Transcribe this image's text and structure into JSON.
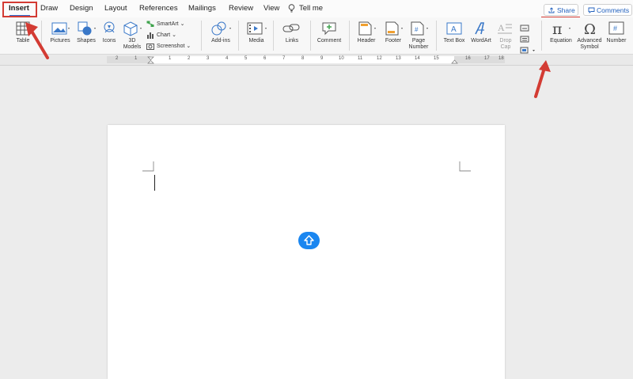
{
  "tabs": [
    {
      "label": "Insert",
      "active": true
    },
    {
      "label": "Draw"
    },
    {
      "label": "Design"
    },
    {
      "label": "Layout"
    },
    {
      "label": "References"
    },
    {
      "label": "Mailings"
    },
    {
      "label": "Review"
    },
    {
      "label": "View"
    },
    {
      "label": "Tell me"
    }
  ],
  "header": {
    "share_label": "Share",
    "comments_label": "Comments"
  },
  "ribbon": {
    "table": "Table",
    "pictures": "Pictures",
    "shapes": "Shapes",
    "icons": "Icons",
    "models_line1": "3D",
    "models_line2": "Models",
    "smartart": "SmartArt",
    "chart": "Chart",
    "screenshot": "Screenshot",
    "addins": "Add-ins",
    "media": "Media",
    "links": "Links",
    "comment": "Comment",
    "header": "Header",
    "footer": "Footer",
    "page_number_line1": "Page",
    "page_number_line2": "Number",
    "text_box": "Text Box",
    "wordart": "WordArt",
    "drop_cap_line1": "Drop",
    "drop_cap_line2": "Cap",
    "equation": "Equation",
    "advanced_symbol_line1": "Advanced",
    "advanced_symbol_line2": "Symbol",
    "number": "Number"
  },
  "ruler": {
    "numbers": [
      "2",
      "1",
      "1",
      "2",
      "3",
      "4",
      "5",
      "6",
      "7",
      "8",
      "9",
      "10",
      "11",
      "12",
      "13",
      "14",
      "15",
      "16",
      "17",
      "18"
    ]
  },
  "colors": {
    "accent": "#2b6ad3",
    "highlight": "#d33b33",
    "float_button": "#1a86f0"
  }
}
